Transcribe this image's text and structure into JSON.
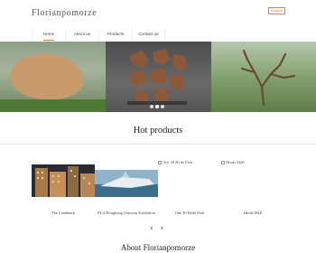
{
  "header": {
    "logo": "Florianpomorze",
    "lang_button": "English"
  },
  "nav": {
    "items": [
      {
        "label": "Home",
        "active": true
      },
      {
        "label": "About us",
        "active": false
      },
      {
        "label": "Products",
        "active": false
      },
      {
        "label": "Contact us",
        "active": false
      }
    ]
  },
  "banner": {
    "slides": 3,
    "active_dot": 1
  },
  "hot_products": {
    "title": "Hot products",
    "items": [
      {
        "caption": "The Landmark",
        "image_text": ""
      },
      {
        "caption": "PLA Hongkong Garrison Exhibition",
        "image_text": ""
      },
      {
        "caption": "One 30 Hyde Park",
        "image_text": "One 30 Hyde Park"
      },
      {
        "caption": "Hinda Mall",
        "image_text": "Hinda Mall"
      }
    ]
  },
  "about": {
    "title": "About Florianpomorze"
  },
  "colors": {
    "accent": "#e07b50"
  },
  "icons": {
    "prev": "chevron-left-icon",
    "next": "chevron-right-icon"
  }
}
